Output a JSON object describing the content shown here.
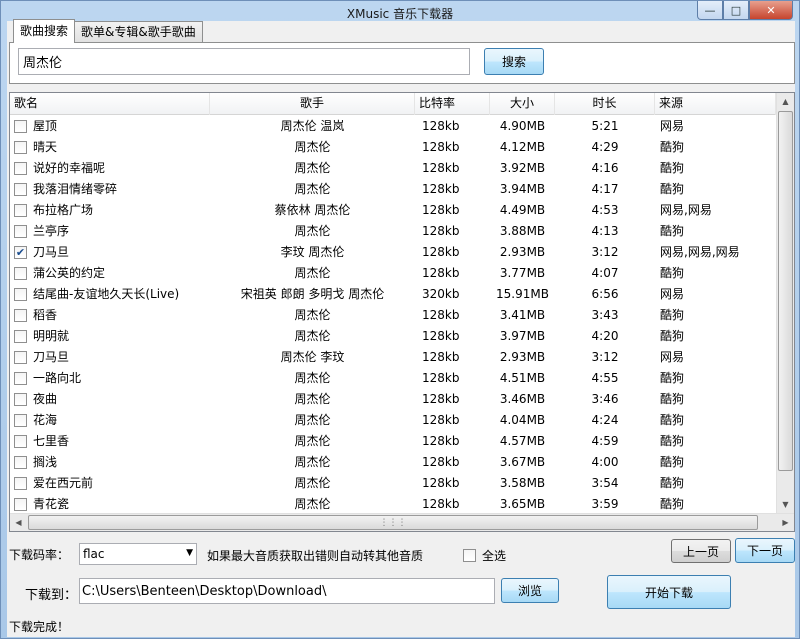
{
  "window": {
    "title": "XMusic 音乐下载器"
  },
  "tabs": [
    {
      "label": "歌曲搜索"
    },
    {
      "label": "歌单&专辑&歌手歌曲"
    }
  ],
  "search": {
    "value": "周杰伦",
    "button_label": "搜索"
  },
  "table": {
    "columns": [
      "歌名",
      "歌手",
      "比特率",
      "大小",
      "时长",
      "来源"
    ],
    "rows": [
      {
        "checked": false,
        "name": "屋顶",
        "artist": "周杰伦 温岚",
        "bitrate": "128kb",
        "size": "4.90MB",
        "duration": "5:21",
        "source": "网易"
      },
      {
        "checked": false,
        "name": "晴天",
        "artist": "周杰伦",
        "bitrate": "128kb",
        "size": "4.12MB",
        "duration": "4:29",
        "source": "酷狗"
      },
      {
        "checked": false,
        "name": "说好的幸福呢",
        "artist": "周杰伦",
        "bitrate": "128kb",
        "size": "3.92MB",
        "duration": "4:16",
        "source": "酷狗"
      },
      {
        "checked": false,
        "name": "我落泪情绪零碎",
        "artist": "周杰伦",
        "bitrate": "128kb",
        "size": "3.94MB",
        "duration": "4:17",
        "source": "酷狗"
      },
      {
        "checked": false,
        "name": "布拉格广场",
        "artist": "蔡依林 周杰伦",
        "bitrate": "128kb",
        "size": "4.49MB",
        "duration": "4:53",
        "source": "网易,网易"
      },
      {
        "checked": false,
        "name": "兰亭序",
        "artist": "周杰伦",
        "bitrate": "128kb",
        "size": "3.88MB",
        "duration": "4:13",
        "source": "酷狗"
      },
      {
        "checked": true,
        "name": "刀马旦",
        "artist": "李玟 周杰伦",
        "bitrate": "128kb",
        "size": "2.93MB",
        "duration": "3:12",
        "source": "网易,网易,网易"
      },
      {
        "checked": false,
        "name": "蒲公英的约定",
        "artist": "周杰伦",
        "bitrate": "128kb",
        "size": "3.77MB",
        "duration": "4:07",
        "source": "酷狗"
      },
      {
        "checked": false,
        "name": "结尾曲-友谊地久天长(Live)",
        "artist": "宋祖英 郎朗 多明戈 周杰伦",
        "bitrate": "320kb",
        "size": "15.91MB",
        "duration": "6:56",
        "source": "网易"
      },
      {
        "checked": false,
        "name": "稻香",
        "artist": "周杰伦",
        "bitrate": "128kb",
        "size": "3.41MB",
        "duration": "3:43",
        "source": "酷狗"
      },
      {
        "checked": false,
        "name": "明明就",
        "artist": "周杰伦",
        "bitrate": "128kb",
        "size": "3.97MB",
        "duration": "4:20",
        "source": "酷狗"
      },
      {
        "checked": false,
        "name": "刀马旦",
        "artist": "周杰伦 李玟",
        "bitrate": "128kb",
        "size": "2.93MB",
        "duration": "3:12",
        "source": "网易"
      },
      {
        "checked": false,
        "name": "一路向北",
        "artist": "周杰伦",
        "bitrate": "128kb",
        "size": "4.51MB",
        "duration": "4:55",
        "source": "酷狗"
      },
      {
        "checked": false,
        "name": "夜曲",
        "artist": "周杰伦",
        "bitrate": "128kb",
        "size": "3.46MB",
        "duration": "3:46",
        "source": "酷狗"
      },
      {
        "checked": false,
        "name": "花海",
        "artist": "周杰伦",
        "bitrate": "128kb",
        "size": "4.04MB",
        "duration": "4:24",
        "source": "酷狗"
      },
      {
        "checked": false,
        "name": "七里香",
        "artist": "周杰伦",
        "bitrate": "128kb",
        "size": "4.57MB",
        "duration": "4:59",
        "source": "酷狗"
      },
      {
        "checked": false,
        "name": "搁浅",
        "artist": "周杰伦",
        "bitrate": "128kb",
        "size": "3.67MB",
        "duration": "4:00",
        "source": "酷狗"
      },
      {
        "checked": false,
        "name": "爱在西元前",
        "artist": "周杰伦",
        "bitrate": "128kb",
        "size": "3.58MB",
        "duration": "3:54",
        "source": "酷狗"
      },
      {
        "checked": false,
        "name": "青花瓷",
        "artist": "周杰伦",
        "bitrate": "128kb",
        "size": "3.65MB",
        "duration": "3:59",
        "source": "酷狗"
      }
    ]
  },
  "download": {
    "bitrate_label": "下载码率：",
    "bitrate_value": "flac",
    "fallback_note": "如果最大音质获取出错则自动转其他音质",
    "select_all_label": "全选",
    "prev_label": "上一页",
    "next_label": "下一页",
    "path_label": "下载到：",
    "path_value": "C:\\Users\\Benteen\\Desktop\\Download\\",
    "browse_label": "浏览",
    "start_label": "开始下载"
  },
  "status": {
    "text": "下载完成！"
  }
}
